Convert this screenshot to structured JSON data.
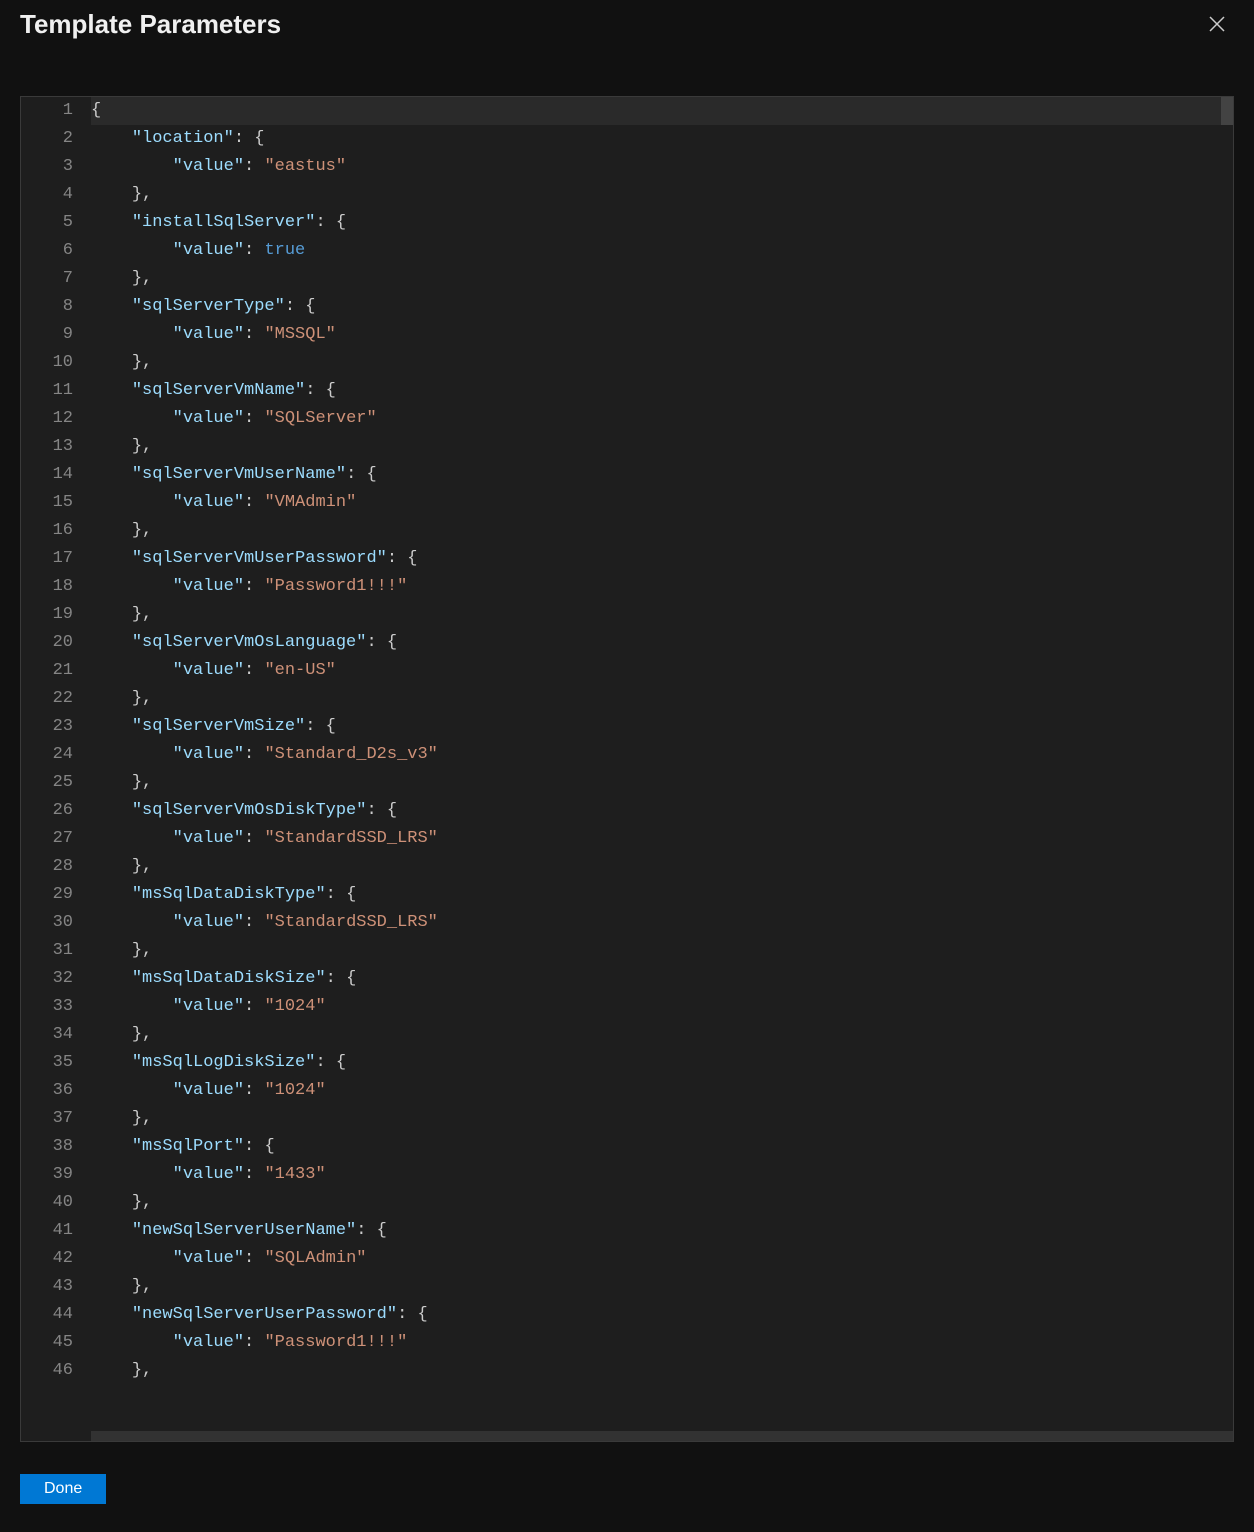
{
  "header": {
    "title": "Template Parameters",
    "close_icon": "close-icon"
  },
  "footer": {
    "done_label": "Done"
  },
  "editor": {
    "start_line": 1,
    "indent": "    ",
    "value_key": "value",
    "cursor_line": 1,
    "entries": [
      {
        "key": "location",
        "value": "eastus",
        "type": "string"
      },
      {
        "key": "installSqlServer",
        "value": true,
        "type": "bool"
      },
      {
        "key": "sqlServerType",
        "value": "MSSQL",
        "type": "string"
      },
      {
        "key": "sqlServerVmName",
        "value": "SQLServer",
        "type": "string"
      },
      {
        "key": "sqlServerVmUserName",
        "value": "VMAdmin",
        "type": "string"
      },
      {
        "key": "sqlServerVmUserPassword",
        "value": "Password1!!!",
        "type": "string"
      },
      {
        "key": "sqlServerVmOsLanguage",
        "value": "en-US",
        "type": "string"
      },
      {
        "key": "sqlServerVmSize",
        "value": "Standard_D2s_v3",
        "type": "string"
      },
      {
        "key": "sqlServerVmOsDiskType",
        "value": "StandardSSD_LRS",
        "type": "string"
      },
      {
        "key": "msSqlDataDiskType",
        "value": "StandardSSD_LRS",
        "type": "string"
      },
      {
        "key": "msSqlDataDiskSize",
        "value": "1024",
        "type": "string"
      },
      {
        "key": "msSqlLogDiskSize",
        "value": "1024",
        "type": "string"
      },
      {
        "key": "msSqlPort",
        "value": "1433",
        "type": "string"
      },
      {
        "key": "newSqlServerUserName",
        "value": "SQLAdmin",
        "type": "string"
      },
      {
        "key": "newSqlServerUserPassword",
        "value": "Password1!!!",
        "type": "string"
      }
    ]
  }
}
